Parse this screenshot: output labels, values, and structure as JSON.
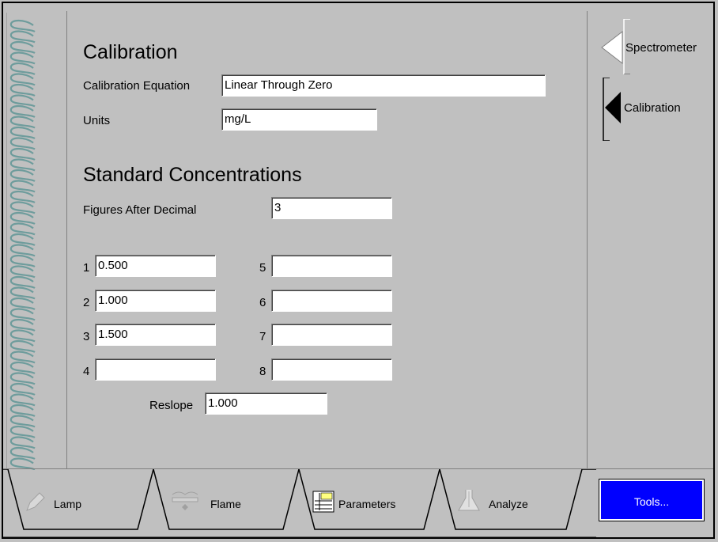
{
  "calibration": {
    "title": "Calibration",
    "equation_label": "Calibration Equation",
    "equation_value": "Linear Through Zero",
    "units_label": "Units",
    "units_value": "mg/L"
  },
  "standards": {
    "title": "Standard Concentrations",
    "figures_label": "Figures After Decimal",
    "figures_value": "3",
    "items": [
      {
        "num": "1",
        "value": "0.500"
      },
      {
        "num": "2",
        "value": "1.000"
      },
      {
        "num": "3",
        "value": "1.500"
      },
      {
        "num": "4",
        "value": ""
      },
      {
        "num": "5",
        "value": ""
      },
      {
        "num": "6",
        "value": ""
      },
      {
        "num": "7",
        "value": ""
      },
      {
        "num": "8",
        "value": ""
      }
    ],
    "reslope_label": "Reslope",
    "reslope_value": "1.000"
  },
  "right_tabs": [
    {
      "label": "Spectrometer",
      "icon": "arrow-left-outline-icon"
    },
    {
      "label": "Calibration",
      "icon": "arrow-left-filled-icon"
    }
  ],
  "bottom_tabs": [
    {
      "label": "Lamp",
      "icon": "pencil-icon"
    },
    {
      "label": "Flame",
      "icon": "flame-burner-icon"
    },
    {
      "label": "Parameters",
      "icon": "parameters-table-icon"
    },
    {
      "label": "Analyze",
      "icon": "flask-icon"
    }
  ],
  "tools_button": "Tools...",
  "colors": {
    "background": "#c0c0c0",
    "tools_bg": "#0000ff",
    "spiral": "#80b0b0"
  }
}
